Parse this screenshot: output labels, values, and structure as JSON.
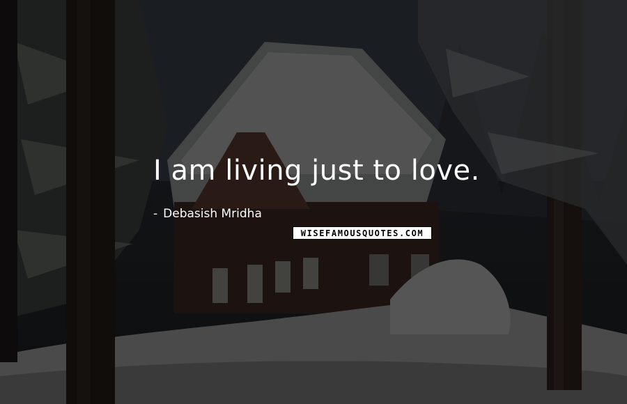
{
  "quote": {
    "text": "I am living just to love."
  },
  "author": {
    "dash": "-",
    "name": "Debasish Mridha"
  },
  "watermark": {
    "text": "WISEFAMOUSQUOTES.COM"
  },
  "background": {
    "scene": "snowy cabin among pine trees at dusk"
  }
}
